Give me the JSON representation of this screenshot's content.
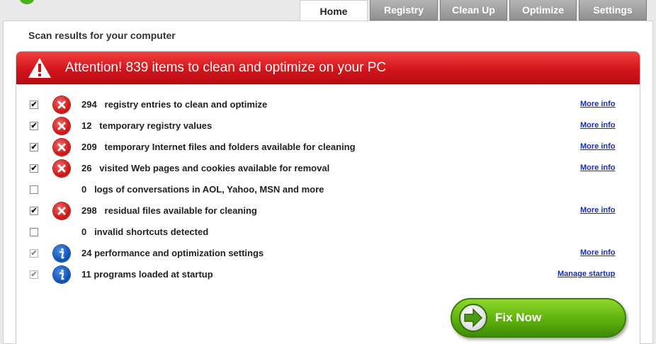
{
  "tabs": [
    {
      "label": "Home"
    },
    {
      "label": "Registry"
    },
    {
      "label": "Clean Up"
    },
    {
      "label": "Optimize"
    },
    {
      "label": "Settings"
    }
  ],
  "page_title": "Scan results for your computer",
  "alert": {
    "text": "Attention! 839 items to clean and optimize on your PC",
    "icon": "warning-triangle-icon"
  },
  "items": [
    {
      "checked": true,
      "enabled": true,
      "icon": "red-x-icon",
      "text": "294   registry entries to clean and optimize",
      "link": "More info"
    },
    {
      "checked": true,
      "enabled": true,
      "icon": "red-x-icon",
      "text": "12   temporary registry values",
      "link": "More info"
    },
    {
      "checked": true,
      "enabled": true,
      "icon": "red-x-icon",
      "text": "209   temporary Internet files and folders available for cleaning",
      "link": "More info"
    },
    {
      "checked": true,
      "enabled": true,
      "icon": "red-x-icon",
      "text": "26   visited Web pages and cookies available for removal",
      "link": "More info"
    },
    {
      "checked": false,
      "enabled": true,
      "icon": "",
      "text": "0   logs of conversations in AOL, Yahoo, MSN and more",
      "link": ""
    },
    {
      "checked": true,
      "enabled": true,
      "icon": "red-x-icon",
      "text": "298   residual files available for cleaning",
      "link": "More info"
    },
    {
      "checked": false,
      "enabled": true,
      "icon": "",
      "text": "0   invalid shortcuts detected",
      "link": ""
    },
    {
      "checked": true,
      "enabled": false,
      "icon": "info-icon",
      "text": "24 performance and optimization settings",
      "link": "More info"
    },
    {
      "checked": true,
      "enabled": false,
      "icon": "info-icon",
      "text": "11 programs loaded at startup",
      "link": "Manage startup"
    }
  ],
  "fix_button": {
    "label": "Fix Now",
    "icon": "arrow-right-icon"
  },
  "colors": {
    "alert_red": "#d4151c",
    "fix_green": "#5fb10e",
    "link_blue": "#1a2fa6",
    "error_red": "#d11a1a",
    "info_blue": "#1256b8"
  }
}
